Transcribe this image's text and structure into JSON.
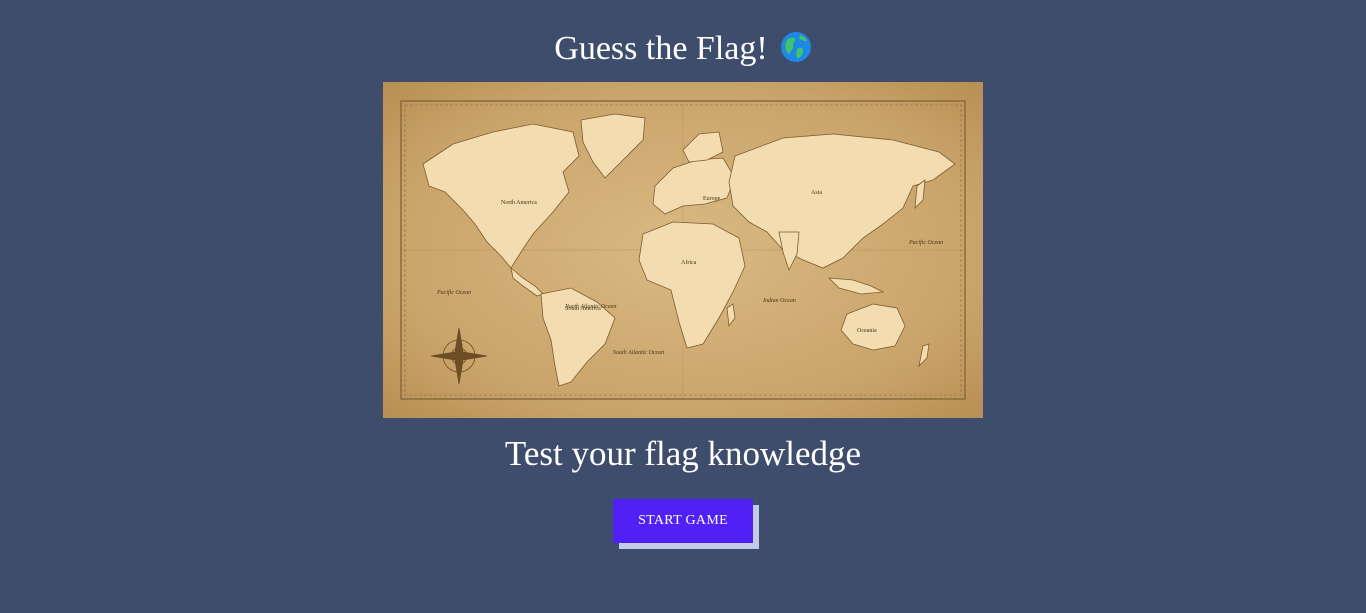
{
  "header": {
    "title": "Guess the Flag!",
    "title_icon": "globe-americas-icon"
  },
  "hero": {
    "image_icon": "vintage-world-map-image",
    "map_labels": {
      "north_america": "North America",
      "south_america": "South America",
      "europe": "Europe",
      "asia": "Asia",
      "africa": "Africa",
      "oceania": "Oceania",
      "north_atlantic": "North Atlantic Ocean",
      "south_atlantic": "South Atlantic Ocean",
      "pacific_left": "Pacific Ocean",
      "pacific_right": "Pacific Ocean",
      "indian": "Indian Ocean"
    },
    "subtitle": "Test your flag knowledge"
  },
  "actions": {
    "start_label": "START GAME"
  },
  "colors": {
    "background": "#3f4d6d",
    "button": "#5120f5",
    "button_shadow": "#c3cce6",
    "map_parchment": "#c9a46a",
    "map_land": "#f2dcb0"
  }
}
